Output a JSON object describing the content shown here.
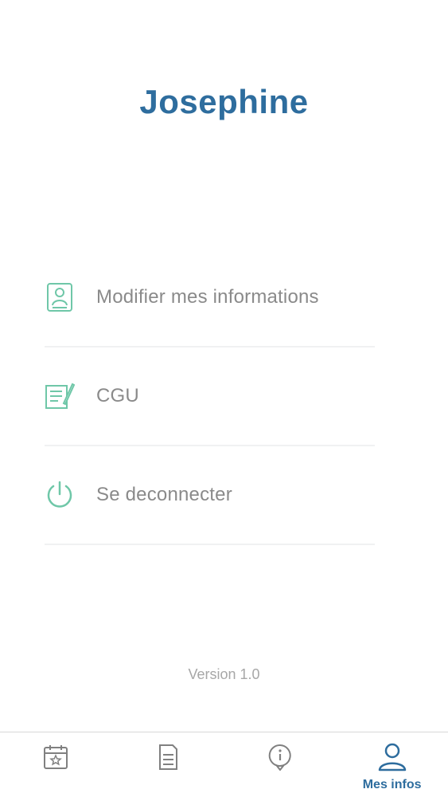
{
  "profile": {
    "name": "Josephine"
  },
  "menu": {
    "items": [
      {
        "label": "Modifier mes informations",
        "icon": "profile-card-icon"
      },
      {
        "label": "CGU",
        "icon": "document-edit-icon"
      },
      {
        "label": "Se deconnecter",
        "icon": "power-icon"
      }
    ]
  },
  "footer": {
    "version": "Version 1.0"
  },
  "tabbar": {
    "tabs": [
      {
        "icon": "calendar-star-icon",
        "label": ""
      },
      {
        "icon": "document-icon",
        "label": ""
      },
      {
        "icon": "info-bubble-icon",
        "label": ""
      },
      {
        "icon": "user-icon",
        "label": "Mes infos",
        "active": true
      }
    ]
  },
  "colors": {
    "brand_blue": "#2e6d9e",
    "accent_green": "#6fc7a8",
    "menu_text": "#8a8a8a",
    "tab_icon_gray": "#808080",
    "divider": "#f0f1f2"
  }
}
